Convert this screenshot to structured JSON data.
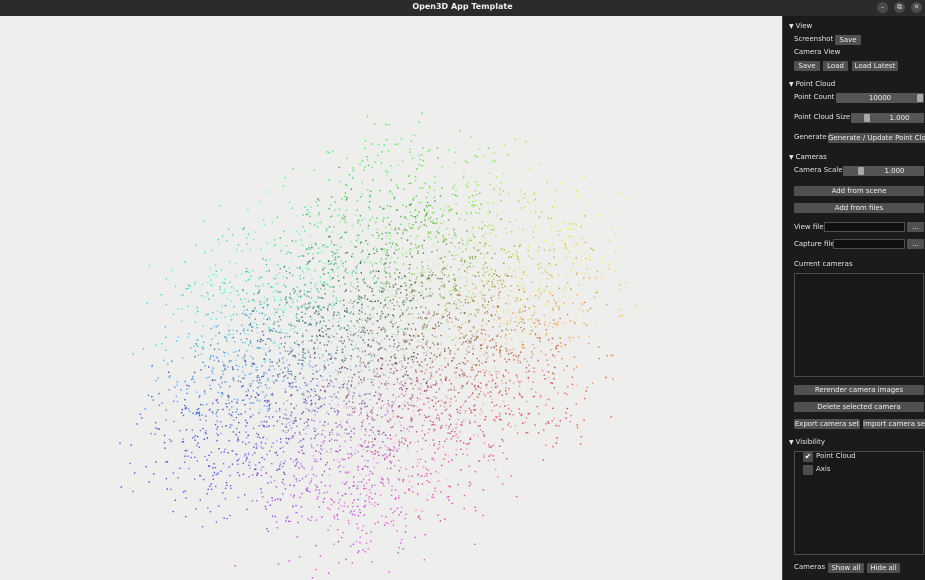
{
  "window": {
    "title": "Open3D App Template",
    "minimize_glyph": "–",
    "restore_glyph": "⧉",
    "close_glyph": "✕"
  },
  "view_section": {
    "header": "View",
    "screenshot_label": "Screenshot",
    "screenshot_save": "Save",
    "camera_view_label": "Camera View",
    "save": "Save",
    "load": "Load",
    "load_latest": "Load Latest"
  },
  "point_cloud_section": {
    "header": "Point Cloud",
    "point_count_label": "Point Count",
    "point_count_value": "10000",
    "size_label": "Point Cloud Size",
    "size_value": "1.000",
    "size_level": 0.2,
    "generate_label": "Generate",
    "generate_button": "Generate / Update Point Cloud"
  },
  "cameras_section": {
    "header": "Cameras",
    "scale_label": "Camera Scale",
    "scale_value": "1.000",
    "scale_level": 0.2,
    "add_from_scene": "Add from scene",
    "add_from_files": "Add from files",
    "view_file_label": "View file",
    "view_file_value": "",
    "browse": "...",
    "capture_file_label": "Capture file",
    "capture_file_value": "",
    "current_cameras_label": "Current cameras",
    "rerender": "Rerender camera images",
    "delete_selected": "Delete selected camera",
    "export_set": "Export camera set",
    "import_set": "Import camera set"
  },
  "visibility_section": {
    "header": "Visibility",
    "items": [
      {
        "label": "Point Cloud",
        "checked": true
      },
      {
        "label": "Axis",
        "checked": false
      }
    ],
    "cameras_label": "Cameras",
    "show_all": "Show all",
    "hide_all": "Hide all"
  },
  "icons": {
    "collapse": "triangle-down-icon",
    "check": "checkmark-icon"
  },
  "colors": {
    "viewport_bg": "#eeeeec",
    "panel_bg": "#1b1b1b",
    "button_bg": "#505050"
  }
}
